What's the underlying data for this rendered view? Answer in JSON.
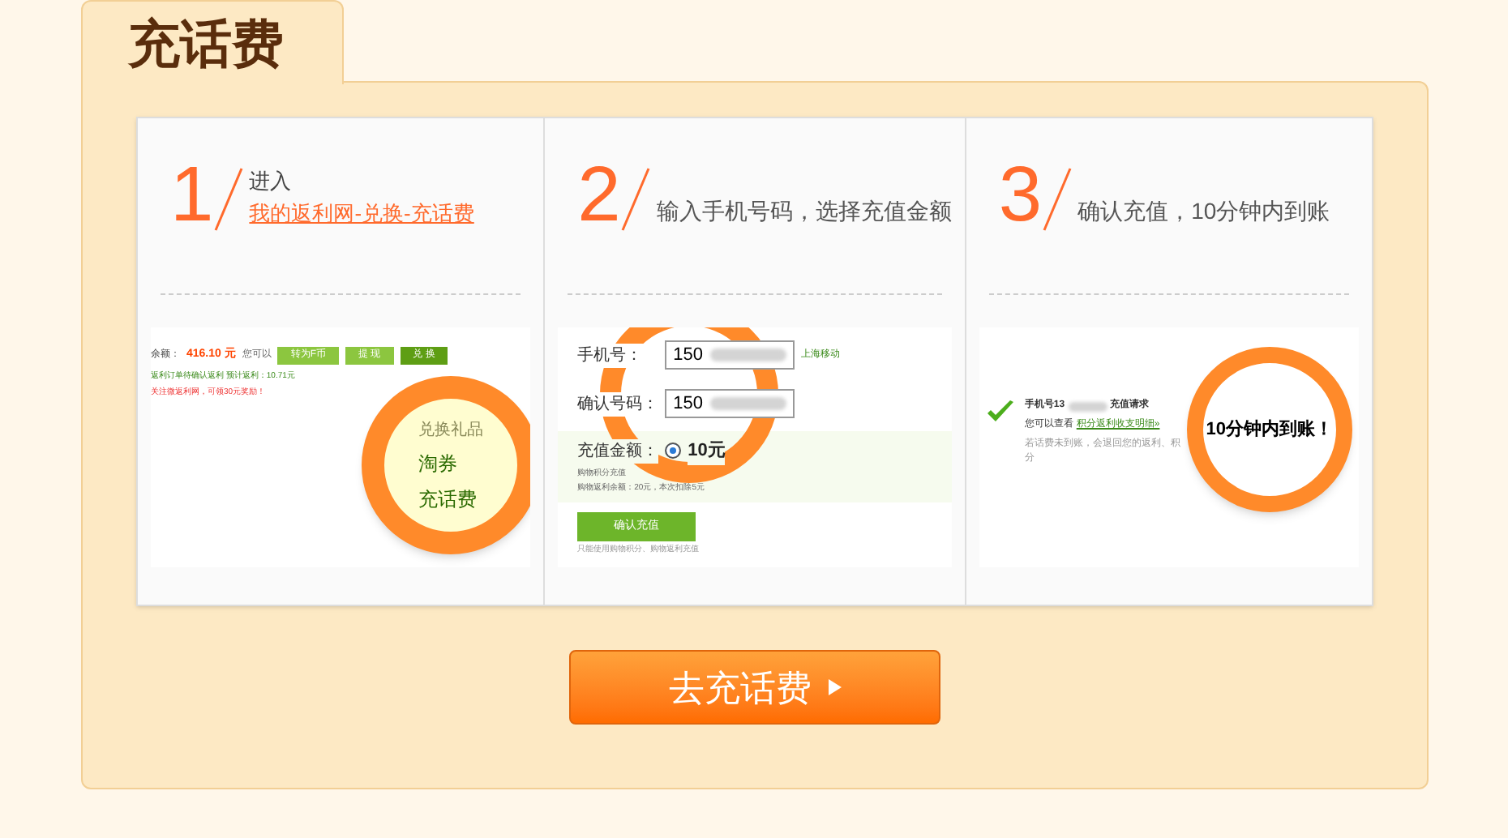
{
  "tab": {
    "label": "充话费"
  },
  "steps": [
    {
      "kind": "enter",
      "number": "1",
      "lead": "进入",
      "link": "我的返利网-兑换-充话费",
      "shot": {
        "balance_label": "余额：",
        "balance": "416.10 元",
        "can": "您可以",
        "buttons": [
          {
            "label": "转为F币",
            "selected": false
          },
          {
            "label": "提 现",
            "selected": false
          },
          {
            "label": "兑 换",
            "selected": true
          }
        ],
        "line1": "返利订单待确认返利 预计返利：10.71元",
        "line2": "关注微返利网，可领30元奖励！",
        "menu": [
          "兑换礼品",
          "淘券",
          "充话费"
        ]
      }
    },
    {
      "kind": "form",
      "number": "2",
      "title": "输入手机号码，选择充值金额",
      "shot": {
        "phone_label": "手机号：",
        "phone": "150",
        "carrier": "上海移动",
        "confirm_label": "确认号码：",
        "confirm": "150",
        "amount_label": "充值金额：",
        "amount": "10元",
        "amount_selected": true,
        "line1": "购物积分充值",
        "line2": "购物返利余额：20元，本次扣除5元",
        "submit": "确认充值",
        "note": "只能使用购物积分、购物返利充值"
      }
    },
    {
      "kind": "done",
      "number": "3",
      "title": "确认充值，10分钟内到账",
      "shot": {
        "line1a": "手机号13",
        "line1b": "充值请求",
        "line2": "您可以查看",
        "link": "积分返利收支明细»",
        "line3": "若话费未到账，会退回您的返利、积分",
        "lens": "10分钟内到账！"
      }
    }
  ],
  "cta": {
    "label": "去充话费"
  }
}
